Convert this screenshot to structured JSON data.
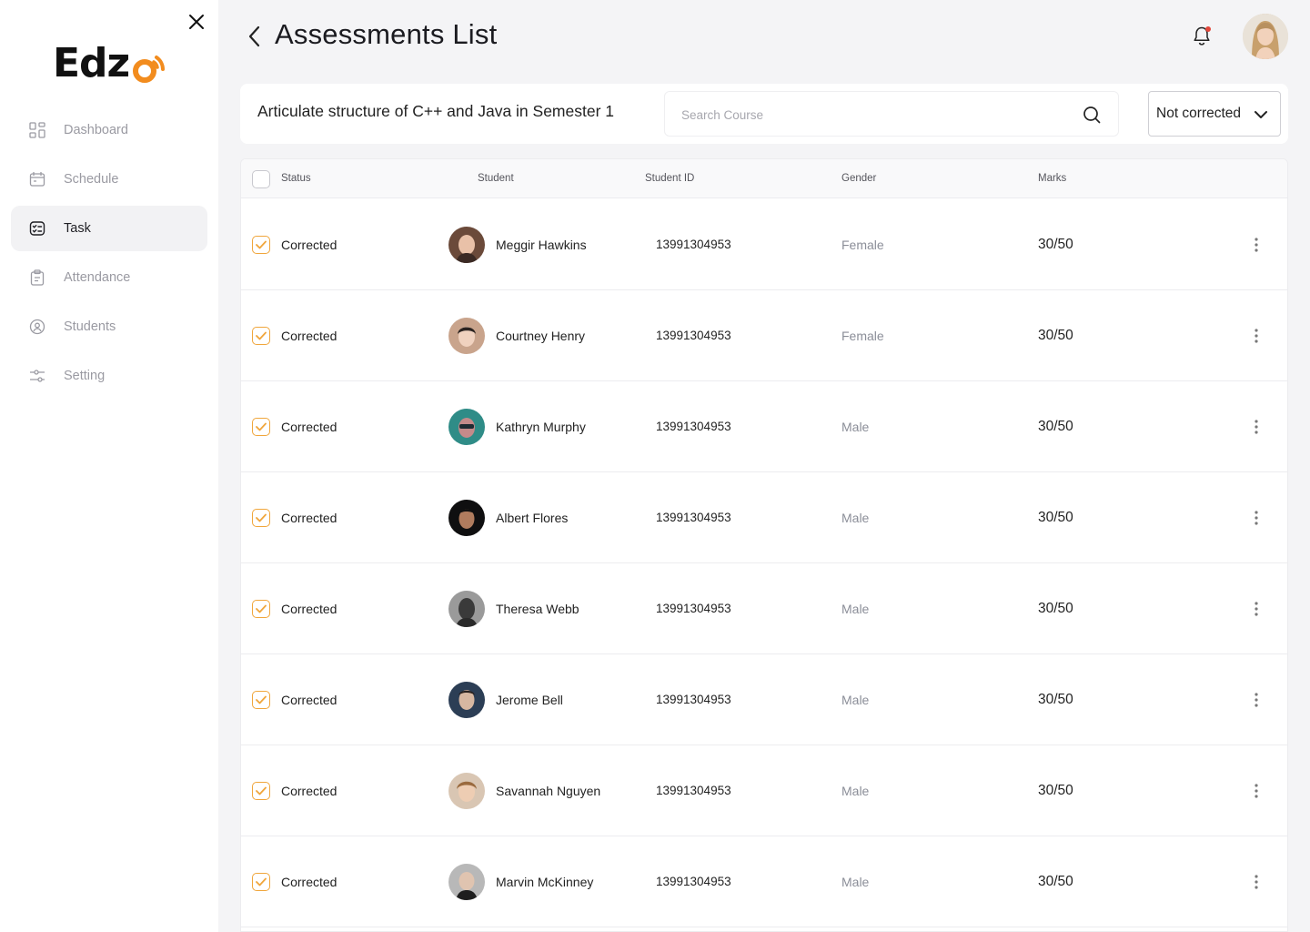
{
  "brand": {
    "name_prefix": "Edz",
    "accent": "#F28C1E"
  },
  "sidebar": {
    "items": [
      {
        "label": "Dashboard",
        "icon": "dashboard-grid-icon",
        "active": false
      },
      {
        "label": "Schedule",
        "icon": "calendar-icon",
        "active": false
      },
      {
        "label": "Task",
        "icon": "task-list-icon",
        "active": true
      },
      {
        "label": "Attendance",
        "icon": "clipboard-icon",
        "active": false
      },
      {
        "label": "Students",
        "icon": "student-badge-icon",
        "active": false
      },
      {
        "label": "Setting",
        "icon": "sliders-icon",
        "active": false
      }
    ]
  },
  "header": {
    "title": "Assessments List"
  },
  "filter": {
    "course_title": "Articulate structure of C++ and Java in Semester 1",
    "search_placeholder": "Search Course",
    "status_value": "Not corrected"
  },
  "table": {
    "columns": [
      "Status",
      "Student",
      "Student ID",
      "Gender",
      "Marks"
    ],
    "rows": [
      {
        "status": "Corrected",
        "name": "Meggir Hawkins",
        "id": "13991304953",
        "gender": "Female",
        "marks": "30/50"
      },
      {
        "status": "Corrected",
        "name": "Courtney Henry",
        "id": "13991304953",
        "gender": "Female",
        "marks": "30/50"
      },
      {
        "status": "Corrected",
        "name": "Kathryn Murphy",
        "id": "13991304953",
        "gender": "Male",
        "marks": "30/50"
      },
      {
        "status": "Corrected",
        "name": "Albert Flores",
        "id": "13991304953",
        "gender": "Male",
        "marks": "30/50"
      },
      {
        "status": "Corrected",
        "name": "Theresa Webb",
        "id": "13991304953",
        "gender": "Male",
        "marks": "30/50"
      },
      {
        "status": "Corrected",
        "name": "Jerome Bell",
        "id": "13991304953",
        "gender": "Male",
        "marks": "30/50"
      },
      {
        "status": "Corrected",
        "name": "Savannah Nguyen",
        "id": "13991304953",
        "gender": "Male",
        "marks": "30/50"
      },
      {
        "status": "Corrected",
        "name": "Marvin McKinney",
        "id": "13991304953",
        "gender": "Male",
        "marks": "30/50"
      }
    ]
  }
}
